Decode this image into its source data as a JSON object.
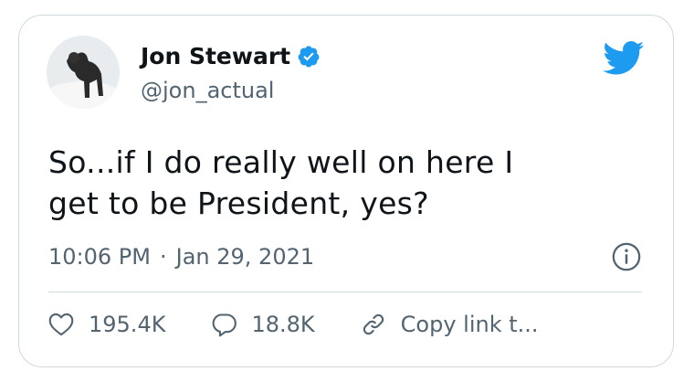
{
  "tweet": {
    "author": {
      "name": "Jon Stewart",
      "handle": "@jon_actual",
      "verified_icon": "verified-badge-icon"
    },
    "text_lines": [
      "So...if I do really well on here I",
      "get to be President, yes?"
    ],
    "time": "10:06 PM",
    "separator": "·",
    "date": "Jan 29, 2021"
  },
  "actions": {
    "likes": "195.4K",
    "replies": "18.8K",
    "copy_link": "Copy link t..."
  },
  "colors": {
    "twitter_blue": "#1d9bf0",
    "text": "#0f1419",
    "muted": "#536471",
    "border": "#cfd9de"
  },
  "icons": [
    "twitter-bird-icon",
    "info-icon",
    "heart-icon",
    "reply-icon",
    "link-icon"
  ]
}
